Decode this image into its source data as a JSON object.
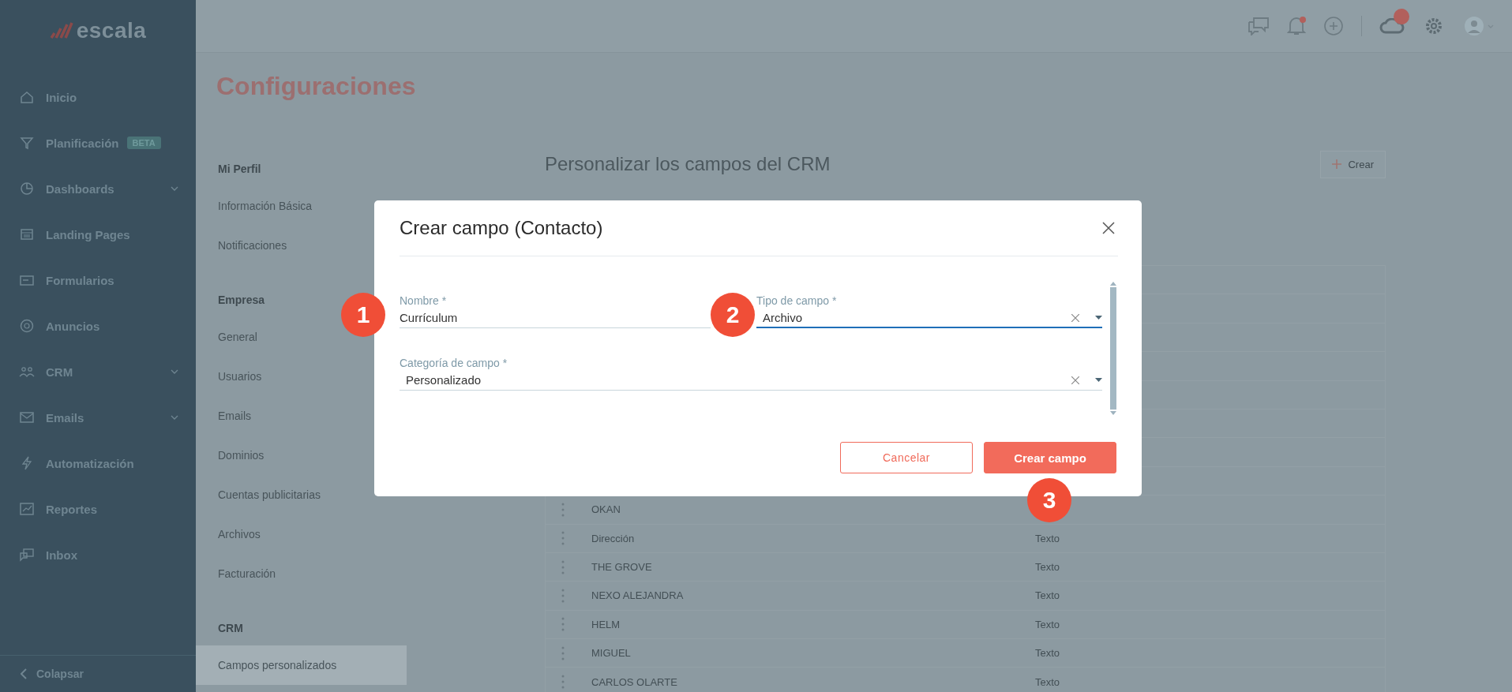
{
  "sidebar": {
    "logo": "escala",
    "items": [
      {
        "label": "Inicio",
        "expandable": false
      },
      {
        "label": "Planificación",
        "badge": "BETA",
        "expandable": false
      },
      {
        "label": "Dashboards",
        "expandable": true
      },
      {
        "label": "Landing Pages",
        "expandable": false
      },
      {
        "label": "Formularios",
        "expandable": false
      },
      {
        "label": "Anuncios",
        "expandable": false
      },
      {
        "label": "CRM",
        "expandable": true
      },
      {
        "label": "Emails",
        "expandable": true
      },
      {
        "label": "Automatización",
        "expandable": false
      },
      {
        "label": "Reportes",
        "expandable": false
      },
      {
        "label": "Inbox",
        "expandable": false
      }
    ],
    "collapse": "Colapsar"
  },
  "header": {
    "notifications_unread": true
  },
  "page_title": "Configuraciones",
  "settings_nav": [
    {
      "title": "Mi Perfil",
      "items": [
        {
          "label": "Información Básica",
          "selected": false
        },
        {
          "label": "Notificaciones",
          "selected": false
        }
      ]
    },
    {
      "title": "Empresa",
      "items": [
        {
          "label": "General",
          "selected": false
        },
        {
          "label": "Usuarios",
          "selected": false
        },
        {
          "label": "Emails",
          "selected": false
        },
        {
          "label": "Dominios",
          "selected": false
        },
        {
          "label": "Cuentas publicitarias",
          "selected": false
        },
        {
          "label": "Archivos",
          "selected": false
        },
        {
          "label": "Facturación",
          "selected": false
        }
      ]
    },
    {
      "title": "CRM",
      "items": [
        {
          "label": "Campos personalizados",
          "selected": true
        }
      ]
    }
  ],
  "content": {
    "title": "Personalizar los campos del CRM",
    "create_button": "Crear",
    "table": {
      "rows": [
        {
          "name": "OKAN"
        },
        {
          "name": "Dirección",
          "type": "Texto"
        },
        {
          "name": "THE GROVE",
          "type": "Texto"
        },
        {
          "name": "NEXO ALEJANDRA",
          "type": "Texto"
        },
        {
          "name": "HELM",
          "type": "Texto"
        },
        {
          "name": "MIGUEL",
          "type": "Texto"
        },
        {
          "name": "CARLOS OLARTE",
          "type": "Texto"
        }
      ]
    }
  },
  "modal": {
    "title": "Crear campo (Contacto)",
    "fields": [
      {
        "kind": "text",
        "label": "Nombre *",
        "value": "Currículum",
        "focused": false,
        "step": "1"
      },
      {
        "kind": "select",
        "label": "Tipo de campo *",
        "value": "Archivo",
        "focused": true,
        "step": "2"
      },
      {
        "kind": "select",
        "label": "Categoría de campo *",
        "value": "Personalizado",
        "focused": false
      }
    ],
    "buttons": [
      {
        "kind": "secondary",
        "label": "Cancelar"
      },
      {
        "kind": "primary",
        "label": "Crear campo",
        "step": "3"
      }
    ]
  }
}
